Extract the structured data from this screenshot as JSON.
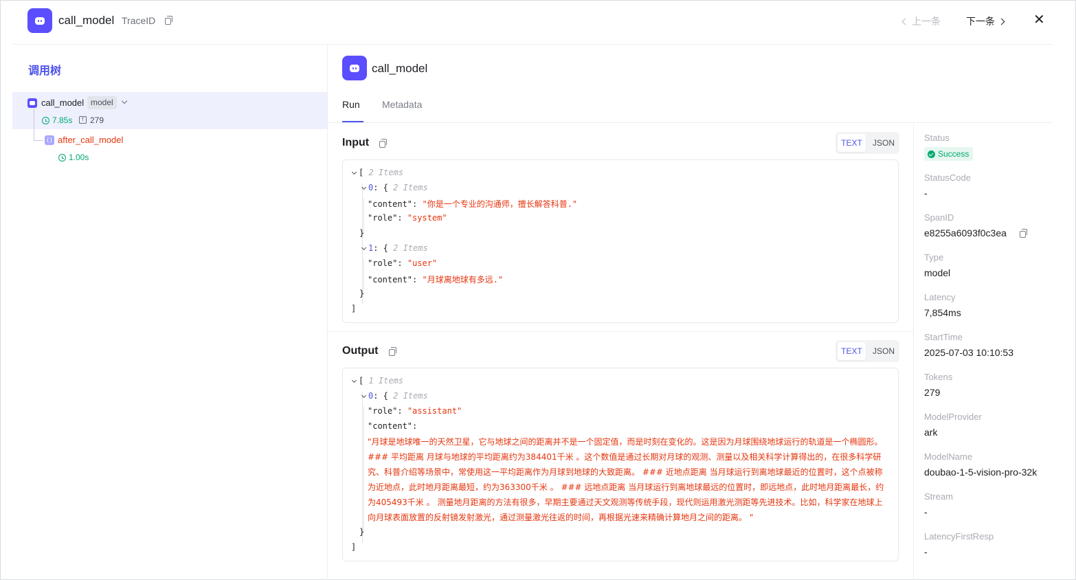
{
  "header": {
    "title": "call_model",
    "traceid_label": "TraceID",
    "prev_label": "上一条",
    "next_label": "下一条",
    "close_label": "✕"
  },
  "tree": {
    "title": "调用树",
    "nodes": [
      {
        "name": "call_model",
        "badge": "model",
        "latency": "7.85s",
        "tokens": "279"
      },
      {
        "name": "after_call_model",
        "latency": "1.00s"
      }
    ]
  },
  "detail": {
    "title": "call_model",
    "tabs": [
      {
        "label": "Run"
      },
      {
        "label": "Metadata"
      }
    ],
    "toggle_text": "TEXT",
    "toggle_json": "JSON",
    "input": {
      "label": "Input",
      "items_meta": "2 Items",
      "item0_meta": "2 Items",
      "item0_content_key": "\"content\"",
      "item0_content_val": "\"你是一个专业的沟通师，擅长解答科普.\"",
      "item0_role_key": "\"role\"",
      "item0_role_val": "\"system\"",
      "item1_meta": "2 Items",
      "item1_role_key": "\"role\"",
      "item1_role_val": "\"user\"",
      "item1_content_key": "\"content\"",
      "item1_content_val": "\"月球离地球有多远.\""
    },
    "output": {
      "label": "Output",
      "items_meta": "1 Items",
      "item0_meta": "2 Items",
      "role_key": "\"role\"",
      "role_val": "\"assistant\"",
      "content_key": "\"content\"",
      "content_val": "\"月球是地球唯一的天然卫星，它与地球之间的距离并不是一个固定值，而是时刻在变化的。这是因为月球围绕地球运行的轨道是一个椭圆形。 ### 平均距离 月球与地球的平均距离约为384401千米 。这个数值是通过长期对月球的观测、测量以及相关科学计算得出的，在很多科学研究、科普介绍等场景中，常使用这一平均距离作为月球到地球的大致距离。 ### 近地点距离 当月球运行到离地球最近的位置时，这个点被称为近地点，此时地月距离最短，约为363300千米 。 ### 远地点距离 当月球运行到离地球最远的位置时，即远地点，此时地月距离最长，约为405493千米 。 测量地月距离的方法有很多，早期主要通过天文观测等传统手段，现代则运用激光测距等先进技术。比如，科学家在地球上向月球表面放置的反射镜发射激光，通过测量激光往返的时间，再根据光速来精确计算地月之间的距离。 \""
    }
  },
  "metadata": [
    {
      "label": "Status",
      "value": "Success"
    },
    {
      "label": "StatusCode",
      "value": "-"
    },
    {
      "label": "SpanID",
      "value": "e8255a6093f0c3ea"
    },
    {
      "label": "Type",
      "value": "model"
    },
    {
      "label": "Latency",
      "value": "7,854ms"
    },
    {
      "label": "StartTime",
      "value": "2025-07-03 10:10:53"
    },
    {
      "label": "Tokens",
      "value": "279"
    },
    {
      "label": "ModelProvider",
      "value": "ark"
    },
    {
      "label": "ModelName",
      "value": "doubao-1-5-vision-pro-32k"
    },
    {
      "label": "Stream",
      "value": "-"
    },
    {
      "label": "LatencyFirstResp",
      "value": "-"
    }
  ],
  "colors": {
    "accent": "#4d53e8",
    "brand_icon": "#5b4eff",
    "success": "#00a870",
    "string": "#e5350e"
  }
}
